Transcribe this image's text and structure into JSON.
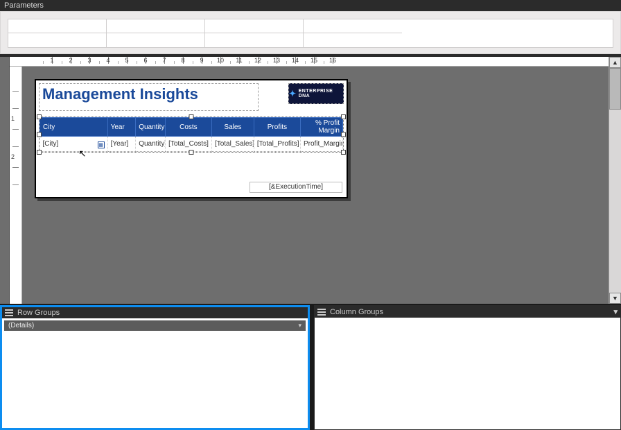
{
  "parameters_title": "Parameters",
  "ruler": {
    "labels": [
      "1",
      "2",
      "3",
      "4",
      "5",
      "6",
      "7",
      "8",
      "9",
      "10",
      "11",
      "12",
      "13",
      "14",
      "15",
      "16"
    ]
  },
  "report": {
    "title": "Management Insights",
    "logo_text": "ENTERPRISE DNA",
    "columns": [
      "City",
      "Year",
      "Quantity",
      "Costs",
      "Sales",
      "Profits",
      "% Profit Margin"
    ],
    "fields": [
      "[City]",
      "[Year]",
      "Quantity]",
      "[Total_Costs]",
      "[Total_Sales]",
      "[Total_Profits]",
      "Profit_Margin]"
    ],
    "execution_placeholder": "[&ExecutionTime]"
  },
  "row_groups": {
    "title": "Row Groups",
    "items": [
      "(Details)"
    ]
  },
  "column_groups": {
    "title": "Column Groups"
  }
}
